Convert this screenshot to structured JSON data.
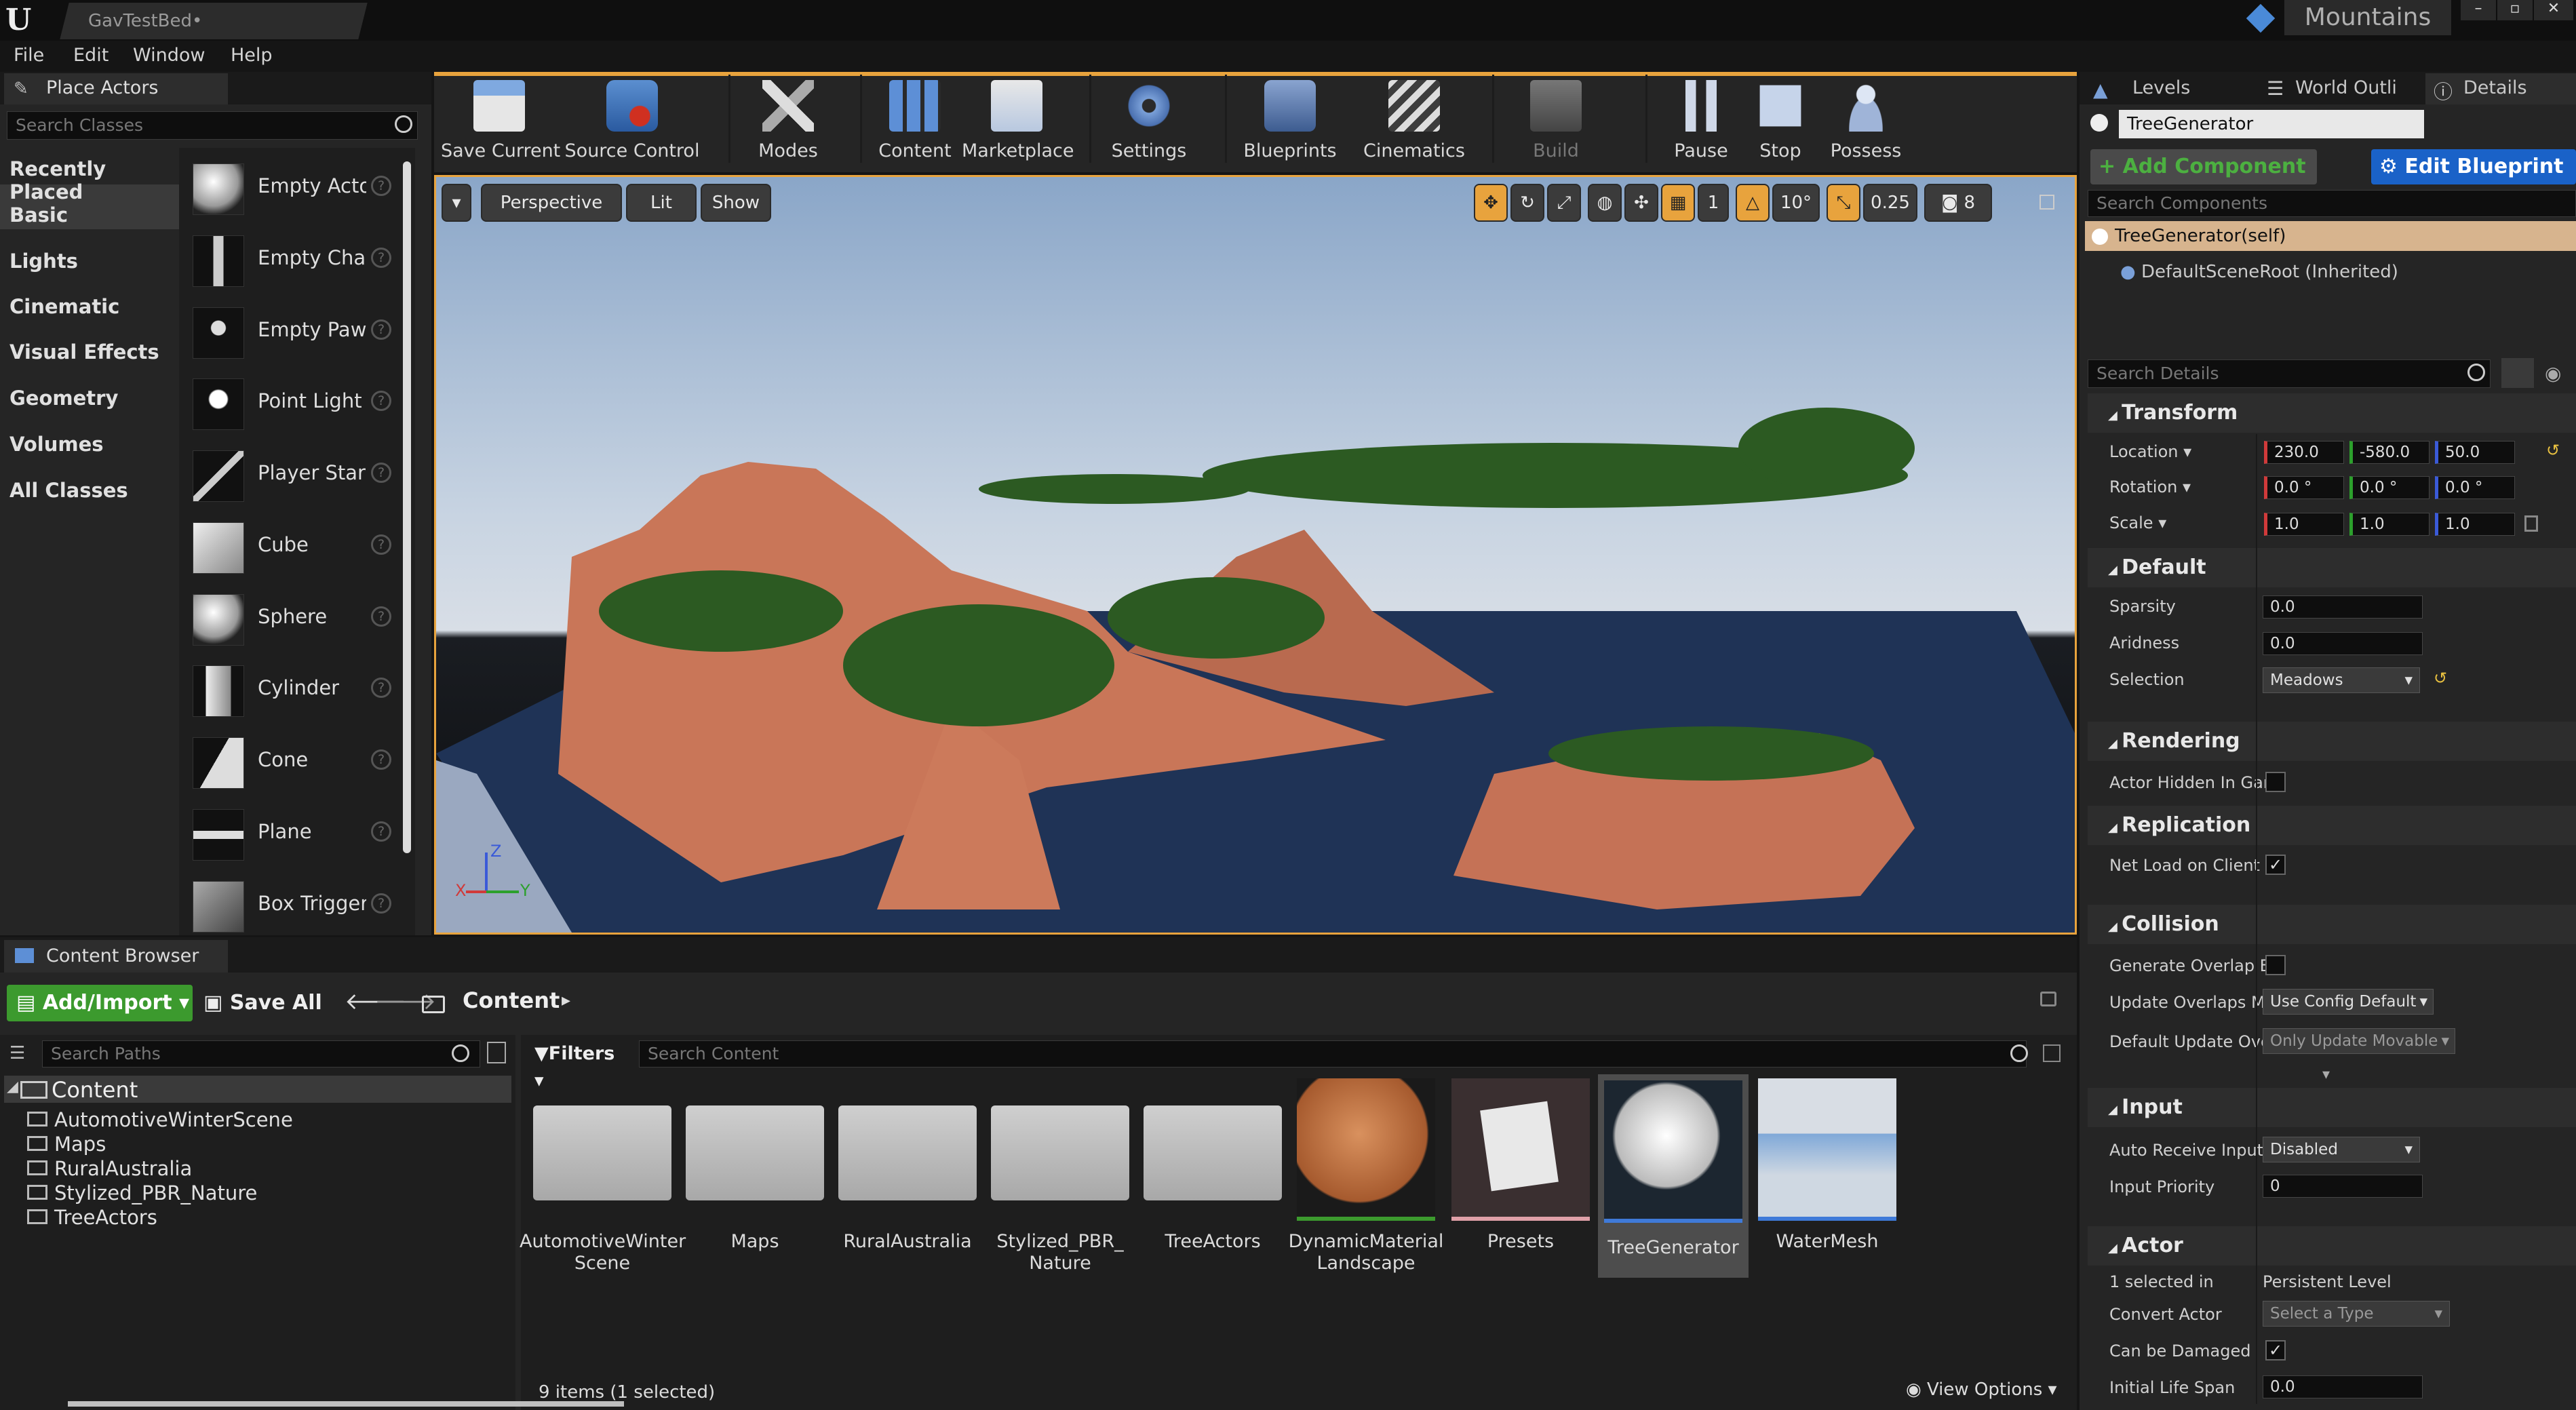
{
  "window": {
    "tab_title": "GavTestBed•",
    "project_name": "Mountains"
  },
  "menu": [
    "File",
    "Edit",
    "Window",
    "Help"
  ],
  "place_actors": {
    "tab_label": "Place Actors",
    "search_placeholder": "Search Classes",
    "categories": [
      "Recently Placed",
      "Basic",
      "Lights",
      "Cinematic",
      "Visual Effects",
      "Geometry",
      "Volumes",
      "All Classes"
    ],
    "selected_category": "Basic",
    "items": [
      "Empty Acto",
      "Empty Char",
      "Empty Paw",
      "Point Light",
      "Player Star",
      "Cube",
      "Sphere",
      "Cylinder",
      "Cone",
      "Plane",
      "Box Trigger"
    ]
  },
  "toolbar": {
    "buttons": [
      "Save Current",
      "Source Control",
      "Modes",
      "Content",
      "Marketplace",
      "Settings",
      "Blueprints",
      "Cinematics",
      "Build",
      "Pause",
      "Stop",
      "Possess"
    ]
  },
  "viewport": {
    "view_mode": "Perspective",
    "lighting": "Lit",
    "show_label": "Show",
    "angle_snap": "10°",
    "scale_snap": "0.25",
    "camera_speed": "8",
    "grid_value": "1",
    "axis_labels": {
      "z": "Z",
      "x": "X",
      "y": "Y"
    }
  },
  "content_browser": {
    "tab_label": "Content Browser",
    "add_import": "Add/Import",
    "save_all": "Save All",
    "breadcrumb": "Content",
    "search_paths_placeholder": "Search Paths",
    "filters_label": "Filters",
    "search_content_placeholder": "Search Content",
    "tree_root": "Content",
    "tree_items": [
      "AutomotiveWinterScene",
      "Maps",
      "RuralAustralia",
      "Stylized_PBR_Nature",
      "TreeActors"
    ],
    "assets": [
      {
        "name": "AutomotiveWinter Scene",
        "kind": "folder"
      },
      {
        "name": "Maps",
        "kind": "folder"
      },
      {
        "name": "RuralAustralia",
        "kind": "folder"
      },
      {
        "name": "Stylized_PBR_ Nature",
        "kind": "folder"
      },
      {
        "name": "TreeActors",
        "kind": "folder"
      },
      {
        "name": "DynamicMaterial Landscape",
        "kind": "material"
      },
      {
        "name": "Presets",
        "kind": "data"
      },
      {
        "name": "TreeGenerator",
        "kind": "blueprint"
      },
      {
        "name": "WaterMesh",
        "kind": "mesh"
      }
    ],
    "selected_asset": "TreeGenerator",
    "status": "9 items (1 selected)",
    "view_options": "View Options"
  },
  "details": {
    "tabs": [
      "Levels",
      "World Outli",
      "Details"
    ],
    "actor_name": "TreeGenerator",
    "add_component": "+ Add Component",
    "edit_blueprint": "Edit Blueprint",
    "search_components_placeholder": "Search Components",
    "component_self": "TreeGenerator(self)",
    "component_root": "DefaultSceneRoot (Inherited)",
    "search_details_placeholder": "Search Details",
    "sections": {
      "transform": "Transform",
      "default": "Default",
      "rendering": "Rendering",
      "replication": "Replication",
      "collision": "Collision",
      "input": "Input",
      "actor": "Actor"
    },
    "location_label": "Location",
    "location": [
      "230.0",
      "-580.0",
      "50.0"
    ],
    "rotation_label": "Rotation",
    "rotation": [
      "0.0 °",
      "0.0 °",
      "0.0 °"
    ],
    "scale_label": "Scale",
    "scale": [
      "1.0",
      "1.0",
      "1.0"
    ],
    "sparsity_label": "Sparsity",
    "sparsity": "0.0",
    "aridness_label": "Aridness",
    "aridness": "0.0",
    "selection_label": "Selection",
    "selection": "Meadows",
    "actor_hidden_label": "Actor Hidden In Gan",
    "net_load_label": "Net Load on Client",
    "net_load_checked": true,
    "generate_overlap_label": "Generate Overlap Ev",
    "update_overlaps_label": "Update Overlaps Me",
    "update_overlaps_value": "Use Config Default",
    "default_update_label": "Default Update Over",
    "default_update_value": "Only Update Movable",
    "auto_receive_label": "Auto Receive Input",
    "auto_receive_value": "Disabled",
    "input_priority_label": "Input Priority",
    "input_priority_value": "0",
    "selected_in_label": "1 selected in",
    "selected_in_value": "Persistent Level",
    "convert_actor_label": "Convert Actor",
    "convert_actor_value": "Select a Type",
    "can_be_damaged_label": "Can be Damaged",
    "can_be_damaged_checked": true,
    "initial_life_span_label": "Initial Life Span",
    "initial_life_span_value": "0.0"
  },
  "colors": {
    "accent_orange": "#e8a33d",
    "edit_blueprint_blue": "#1a62c8",
    "add_import_green": "#3c9a2e",
    "selection_bg": "#4d4d4d"
  },
  "icons": [
    "unreal-logo-icon",
    "search-icon",
    "save-icon",
    "source-control-icon",
    "modes-icon",
    "content-icon",
    "marketplace-icon",
    "settings-icon",
    "blueprints-icon",
    "cinematics-icon",
    "build-icon",
    "pause-icon",
    "stop-icon",
    "possess-icon",
    "folder-icon",
    "back-arrow-icon",
    "forward-arrow-icon",
    "lock-icon",
    "eye-icon",
    "filter-icon"
  ]
}
